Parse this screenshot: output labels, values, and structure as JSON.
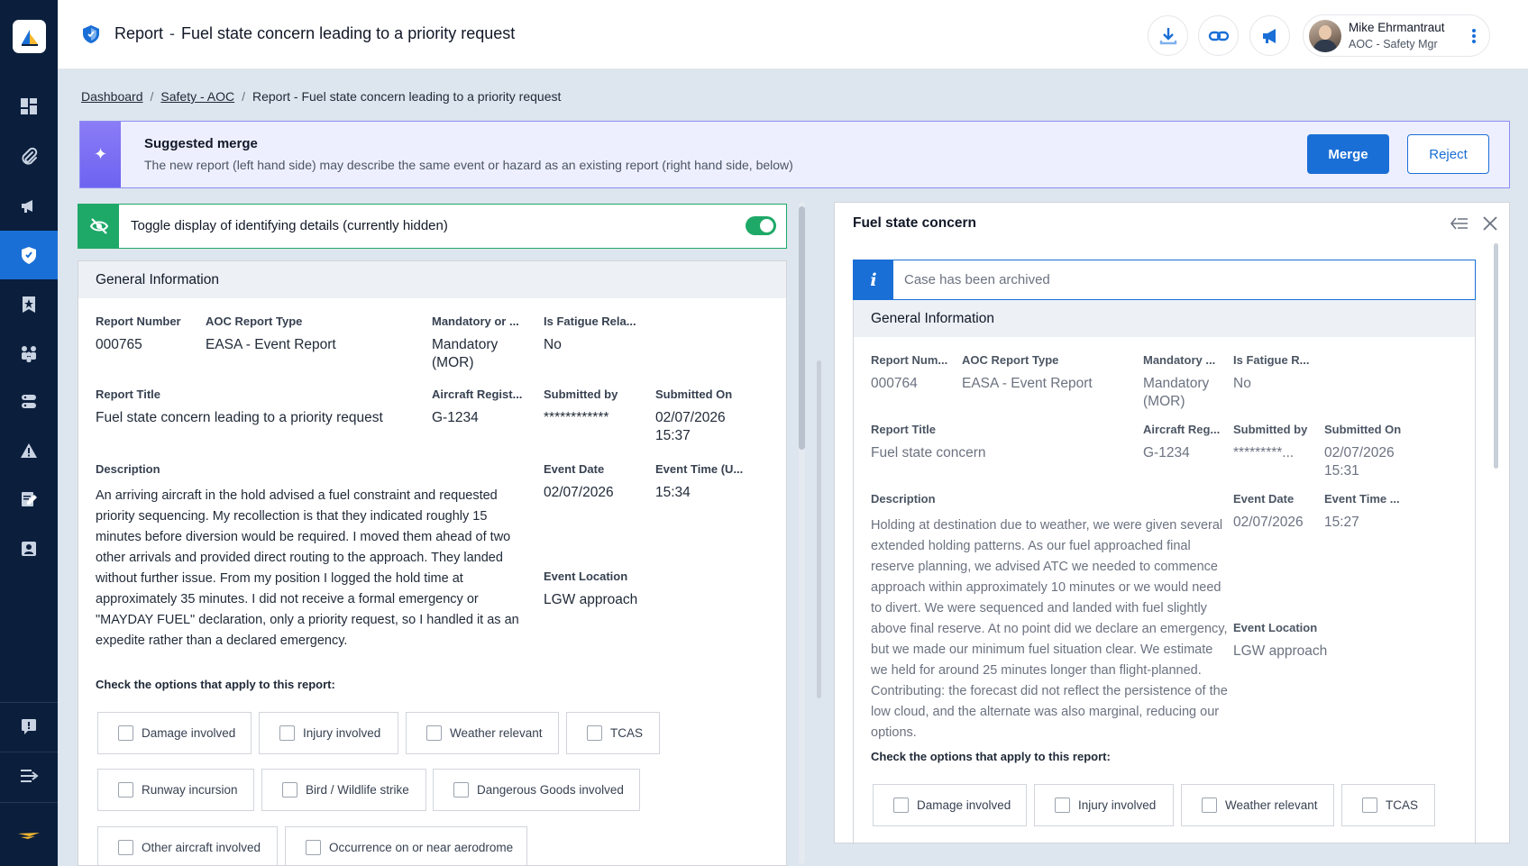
{
  "sidebar": {
    "logo_name": "app-logo",
    "items": [
      {
        "name": "dashboard-icon",
        "active": false
      },
      {
        "name": "paperclip-icon",
        "active": false
      },
      {
        "name": "megaphone-icon",
        "active": false
      },
      {
        "name": "shield-icon",
        "active": true
      },
      {
        "name": "star-bookmark-icon",
        "active": false
      },
      {
        "name": "people-icon",
        "active": false
      },
      {
        "name": "server-icon",
        "active": false
      },
      {
        "name": "warning-icon",
        "active": false
      },
      {
        "name": "edit-document-icon",
        "active": false
      },
      {
        "name": "contact-card-icon",
        "active": false
      }
    ],
    "bottom_items": [
      {
        "name": "feedback-icon"
      },
      {
        "name": "expand-menu-icon"
      },
      {
        "name": "brand-wing-icon"
      }
    ]
  },
  "header": {
    "title_prefix": "Report",
    "title_sep": "-",
    "title_text": "Fuel state concern leading to a priority request",
    "buttons": [
      "download-icon",
      "link-icon",
      "megaphone-icon"
    ],
    "user_name": "Mike Ehrmantraut",
    "user_role": "AOC - Safety Mgr"
  },
  "breadcrumb": {
    "items": [
      "Dashboard",
      "Safety - AOC"
    ],
    "current": "Report - Fuel state concern leading to a priority request",
    "sep": "/"
  },
  "merge": {
    "title": "Suggested merge",
    "description": "The new report (left hand side) may describe the same event or hazard as an existing report (right hand side, below)",
    "merge_label": "Merge",
    "reject_label": "Reject"
  },
  "toggle": {
    "label": "Toggle display of identifying details (currently hidden)",
    "on": true
  },
  "left_report": {
    "section_title": "General Information",
    "report_number_label": "Report Number",
    "report_number": "000765",
    "aoc_type_label": "AOC Report Type",
    "aoc_type": "EASA - Event Report",
    "mandatory_label": "Mandatory or ...",
    "mandatory_line1": "Mandatory",
    "mandatory_line2": "(MOR)",
    "fatigue_label": "Is Fatigue Rela...",
    "fatigue": "No",
    "title_label": "Report Title",
    "title": "Fuel state concern leading to a priority request",
    "aircraft_label": "Aircraft Regist...",
    "aircraft": "G-1234",
    "submitted_by_label": "Submitted by",
    "submitted_by": "************",
    "submitted_on_label": "Submitted On",
    "submitted_on_date": "02/07/2026",
    "submitted_on_time": "15:37",
    "description_label": "Description",
    "description": "An arriving aircraft in the hold advised a fuel constraint and requested priority sequencing. My recollection is that they indicated roughly 15 minutes before diversion would be required. I moved them ahead of two other arrivals and provided direct routing to the approach. They landed without further issue. From my position I logged the hold time at approximately 35 minutes. I did not receive a formal emergency or \"MAYDAY FUEL\" declaration, only a priority request, so I handled it as an expedite rather than a declared emergency.",
    "event_date_label": "Event Date",
    "event_date": "02/07/2026",
    "event_time_label": "Event Time (U...",
    "event_time": "15:34",
    "event_location_label": "Event Location",
    "event_location": "LGW approach",
    "options_title": "Check the options that apply to this report:",
    "options": [
      "Damage involved",
      "Injury involved",
      "Weather relevant",
      "TCAS",
      "Runway incursion",
      "Bird / Wildlife strike",
      "Dangerous Goods involved",
      "Other aircraft involved",
      "Occurrence on or near aerodrome"
    ]
  },
  "right_report": {
    "panel_title": "Fuel state concern",
    "archived_text": "Case has been archived",
    "section_title": "General Information",
    "report_number_label": "Report Num...",
    "report_number": "000764",
    "aoc_type_label": "AOC Report Type",
    "aoc_type": "EASA - Event Report",
    "mandatory_label": "Mandatory ...",
    "mandatory_line1": "Mandatory",
    "mandatory_line2": "(MOR)",
    "fatigue_label": "Is Fatigue R...",
    "fatigue": "No",
    "title_label": "Report Title",
    "title": "Fuel state concern",
    "aircraft_label": "Aircraft Reg...",
    "aircraft": "G-1234",
    "submitted_by_label": "Submitted by",
    "submitted_by": "*********...",
    "submitted_on_label": "Submitted On",
    "submitted_on_date": "02/07/2026",
    "submitted_on_time": "15:31",
    "description_label": "Description",
    "description": "Holding at destination due to weather, we were given several extended holding patterns. As our fuel approached final reserve planning, we advised ATC we needed to commence approach within approximately 10 minutes or we would need to divert. We were sequenced and landed with fuel slightly above final reserve. At no point did we declare an emergency, but we made our minimum fuel situation clear. We estimate we held for around 25 minutes longer than flight-planned. Contributing: the forecast did not reflect the persistence of the low cloud, and the alternate was also marginal, reducing our options.",
    "event_date_label": "Event Date",
    "event_date": "02/07/2026",
    "event_time_label": "Event Time ...",
    "event_time": "15:27",
    "event_location_label": "Event Location",
    "event_location": "LGW approach",
    "options_title": "Check the options that apply to this report:",
    "options": [
      "Damage involved",
      "Injury involved",
      "Weather relevant",
      "TCAS"
    ]
  },
  "colors": {
    "sidebar_bg": "#0b1f3d",
    "accent_blue": "#1a6fd6",
    "merge_purple": "#6d63f0",
    "toggle_green": "#1fa968",
    "page_bg": "#dde5ee"
  }
}
